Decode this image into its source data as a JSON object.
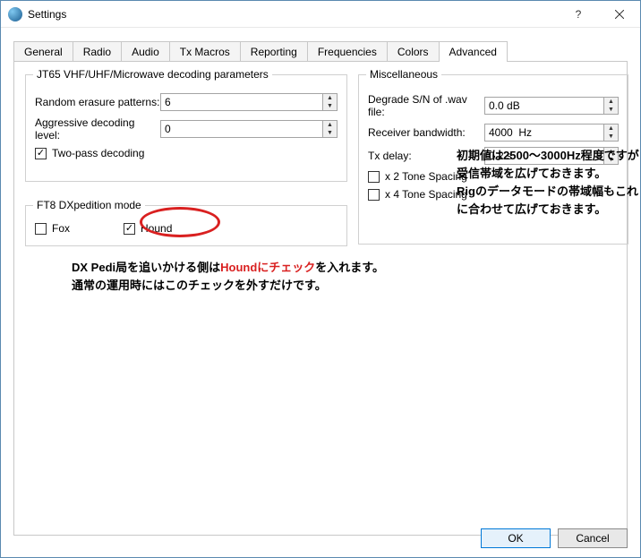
{
  "window": {
    "title": "Settings"
  },
  "tabs": {
    "general": "General",
    "radio": "Radio",
    "audio": "Audio",
    "txmacros": "Tx Macros",
    "reporting": "Reporting",
    "frequencies": "Frequencies",
    "colors": "Colors",
    "advanced": "Advanced"
  },
  "jt65": {
    "legend": "JT65 VHF/UHF/Microwave decoding parameters",
    "random_erasure_label": "Random erasure patterns:",
    "random_erasure_value": "6",
    "aggressive_label": "Aggressive decoding level:",
    "aggressive_value": "0",
    "twopass_label": "Two-pass decoding",
    "twopass_checked": true
  },
  "misc": {
    "legend": "Miscellaneous",
    "degrade_label": "Degrade S/N of .wav file:",
    "degrade_value": "0.0 dB",
    "rxbw_label": "Receiver bandwidth:",
    "rxbw_value": "4000  Hz",
    "txdelay_label": "Tx delay:",
    "txdelay_value": "0.2 s",
    "x2tone_label": "x 2 Tone Spacing",
    "x2tone_checked": false,
    "x4tone_label": "x 4 Tone Spacing",
    "x4tone_checked": false
  },
  "ft8": {
    "legend": "FT8 DXpedition mode",
    "fox_label": "Fox",
    "fox_checked": false,
    "hound_label": "Hound",
    "hound_checked": true
  },
  "annotations": {
    "rx_note": "初期値は2500〜3000Hz程度ですが受信帯域を広げておきます。\nRigのデータモードの帯域幅もこれに合わせて広げておきます。",
    "main_line1_pre": "DX Pedi局を追いかける側は",
    "main_line1_red": "Houndにチェック",
    "main_line1_post": "を入れます。",
    "main_line2": "通常の運用時にはこのチェックを外すだけです。"
  },
  "buttons": {
    "ok": "OK",
    "cancel": "Cancel"
  },
  "checkmark": "✓"
}
